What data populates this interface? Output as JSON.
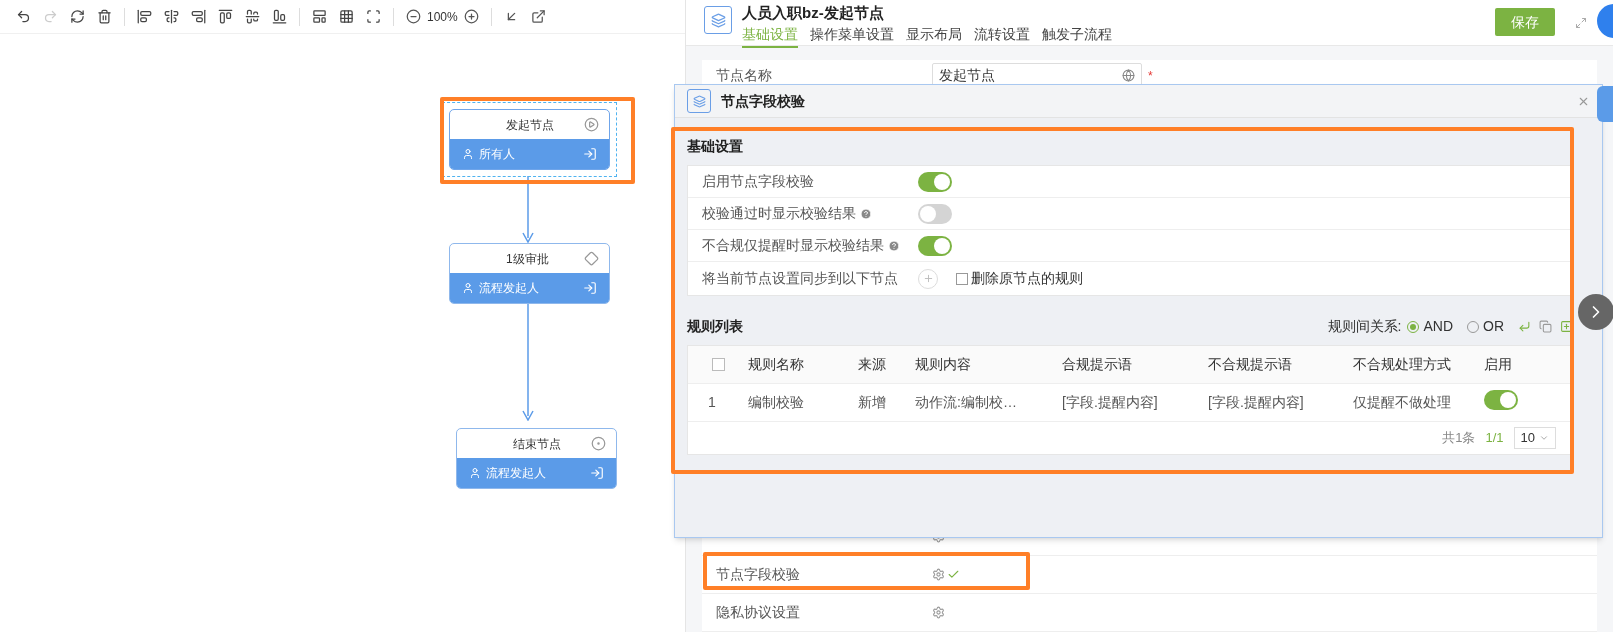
{
  "toolbar": {
    "zoom": "100%"
  },
  "flow": {
    "nodes": [
      {
        "kind": "start",
        "title": "发起节点",
        "assignee": "所有人",
        "selected": true
      },
      {
        "kind": "approval",
        "title": "1级审批",
        "assignee": "流程发起人",
        "selected": false
      },
      {
        "kind": "end",
        "title": "结束节点",
        "assignee": "流程发起人",
        "selected": false
      }
    ]
  },
  "panel": {
    "title": "人员入职bz-发起节点",
    "save_button": "保存",
    "tabs": [
      {
        "label": "基础设置",
        "selected": true
      },
      {
        "label": "操作菜单设置",
        "selected": false
      },
      {
        "label": "显示布局",
        "selected": false
      },
      {
        "label": "流转设置",
        "selected": false
      },
      {
        "label": "触发子流程",
        "selected": false
      }
    ],
    "node_name": {
      "label": "节点名称",
      "value": "发起节点",
      "required_mark": "*"
    },
    "settings": [
      {
        "label": "节点字段校验",
        "configured": true
      },
      {
        "label": "隐私协议设置",
        "configured": false
      }
    ]
  },
  "modal": {
    "title": "节点字段校验",
    "basic": {
      "heading": "基础设置",
      "toggles": [
        {
          "label": "启用节点字段校验",
          "help": false,
          "on": true
        },
        {
          "label": "校验通过时显示校验结果",
          "help": true,
          "on": false
        },
        {
          "label": "不合规仅提醒时显示校验结果",
          "help": true,
          "on": true
        }
      ],
      "sync": {
        "label": "将当前节点设置同步到以下节点",
        "checkbox_label": "删除原节点的规则",
        "checked": false
      }
    },
    "rules": {
      "heading": "规则列表",
      "relation_label": "规则间关系:",
      "relation_options": [
        {
          "label": "AND",
          "selected": true
        },
        {
          "label": "OR",
          "selected": false
        }
      ],
      "select_all_checked": false,
      "columns": [
        "规则名称",
        "来源",
        "规则内容",
        "合规提示语",
        "不合规提示语",
        "不合规处理方式",
        "启用"
      ],
      "rows": [
        {
          "index": "1",
          "cells": [
            "编制校验",
            "新增",
            "动作流:编制校…",
            "[字段.提醒内容]",
            "[字段.提醒内容]",
            "仅提醒不做处理"
          ],
          "enabled": true
        }
      ],
      "pagination": {
        "total": "共1条",
        "page": "1/1",
        "page_size": "10"
      }
    }
  }
}
